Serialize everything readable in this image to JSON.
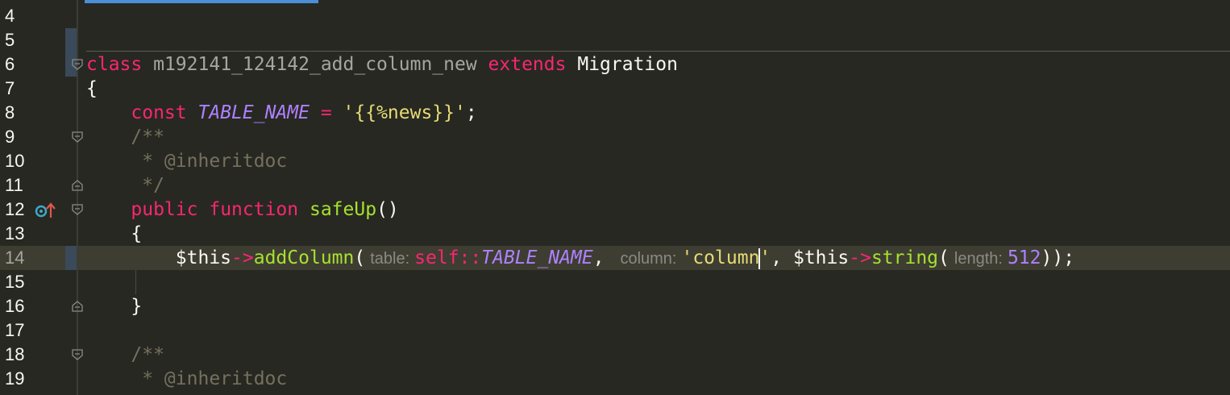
{
  "editor": {
    "lines": [
      {
        "num": "4"
      },
      {
        "num": "5"
      },
      {
        "num": "6"
      },
      {
        "num": "7"
      },
      {
        "num": "8"
      },
      {
        "num": "9"
      },
      {
        "num": "10"
      },
      {
        "num": "11"
      },
      {
        "num": "12"
      },
      {
        "num": "13"
      },
      {
        "num": "14"
      },
      {
        "num": "15"
      },
      {
        "num": "16"
      },
      {
        "num": "17"
      },
      {
        "num": "18"
      },
      {
        "num": "19"
      }
    ],
    "code": {
      "l6": {
        "kw_class": "class",
        "class_name": "m192141_124142_add_column_new",
        "kw_extends": "extends",
        "parent": "Migration"
      },
      "l7": {
        "brace": "{"
      },
      "l8": {
        "kw_const": "const",
        "const_name": "TABLE_NAME",
        "eq": " = ",
        "str": "'{{%news}}'",
        "semi": ";"
      },
      "l9": {
        "comment": "/**"
      },
      "l10": {
        "comment": " * @inheritdoc"
      },
      "l11": {
        "comment": " */"
      },
      "l12": {
        "kw_public": "public",
        "kw_function": "function",
        "fn_name": "safeUp",
        "parens": "()"
      },
      "l13": {
        "brace": "{"
      },
      "l14": {
        "this1": "$this",
        "arrow1": "->",
        "method1": "addColumn",
        "open1": "(",
        "hint_table": "table:",
        "self": "self::",
        "self_const": "TABLE_NAME",
        "comma1": ",",
        "hint_column": "column:",
        "str_before_caret": "'column",
        "str_after_caret": "'",
        "comma2": ", ",
        "this2": "$this",
        "arrow2": "->",
        "method2": "string",
        "open2": "(",
        "hint_length": "length:",
        "num": "512",
        "close": "));"
      },
      "l16": {
        "brace": "}"
      },
      "l18": {
        "comment": "/**"
      },
      "l19": {
        "comment": " * @inheritdoc"
      }
    },
    "gutter_icons": {
      "l12": "override-method-icon"
    }
  }
}
